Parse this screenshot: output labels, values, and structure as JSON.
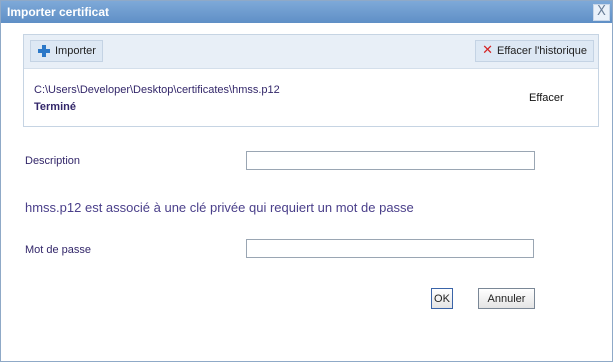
{
  "window": {
    "title": "Importer certificat",
    "close_glyph": "X"
  },
  "toolbar": {
    "import_label": "Importer",
    "clear_history_label": "Effacer l'historique"
  },
  "file_entry": {
    "path": "C:\\Users\\Developer\\Desktop\\certificates\\hmss.p12",
    "status": "Terminé",
    "clear_label": "Effacer"
  },
  "form": {
    "description_label": "Description",
    "description_value": "",
    "message": "hmss.p12 est associé à une clé privée qui requiert un mot de passe",
    "password_label": "Mot de passe",
    "password_value": ""
  },
  "buttons": {
    "ok_label": "OK",
    "cancel_label": "Annuler"
  },
  "colors": {
    "title_bar": "#5f8fc6",
    "label_text": "#33276a",
    "message_text": "#4a3f8a",
    "clear_icon": "#d42323",
    "import_icon": "#2b78c8"
  },
  "icons": {
    "import": "plus-icon",
    "clear_history": "x-icon",
    "close": "close-icon"
  }
}
